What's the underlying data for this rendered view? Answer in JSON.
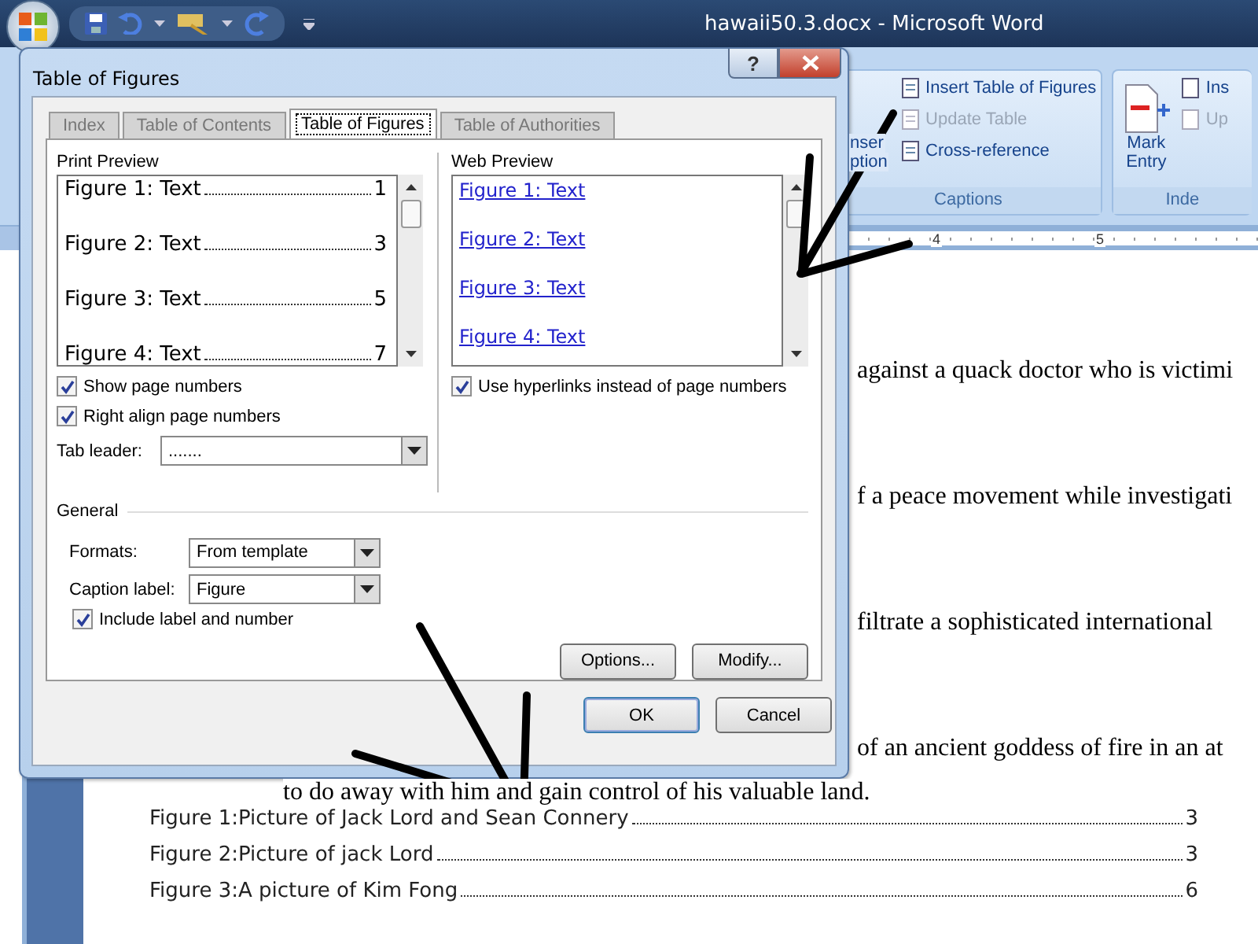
{
  "word_window": {
    "title": "hawaii50.3.docx - Microsoft Word"
  },
  "ribbon": {
    "cut_button_lines": [
      "nser",
      "ption"
    ],
    "captions_group": {
      "label": "Captions",
      "items": [
        {
          "label": "Insert Table of Figures",
          "disabled": false
        },
        {
          "label": "Update Table",
          "disabled": true
        },
        {
          "label": "Cross-reference",
          "disabled": false
        }
      ]
    },
    "index_group": {
      "label": "Inde",
      "mark_entry": [
        "Mark",
        "Entry"
      ],
      "items": [
        {
          "label": "Ins",
          "disabled": false
        },
        {
          "label": "Up",
          "disabled": true
        }
      ]
    }
  },
  "ruler": {
    "numbers": [
      "4",
      "5"
    ]
  },
  "document": {
    "lines": [
      "against a quack doctor who is victimi",
      "f a peace movement while investigati",
      "filtrate a sophisticated international",
      "of an ancient goddess of fire in an at"
    ],
    "continuation": "to do away with him and gain control of his valuable land.",
    "table_of_figures": [
      {
        "entry": "Figure 1:Picture of Jack Lord and Sean Connery",
        "page": "3"
      },
      {
        "entry": "Figure 2:Picture of jack Lord",
        "page": "3"
      },
      {
        "entry": "Figure 3:A picture of Kim Fong",
        "page": "6"
      }
    ]
  },
  "dialog": {
    "title": "Table of Figures",
    "help": "?",
    "tabs": [
      {
        "label": "Index",
        "selected": false
      },
      {
        "label": "Table of Contents",
        "selected": false
      },
      {
        "label": "Table of Figures",
        "selected": true
      },
      {
        "label": "Table of Authorities",
        "selected": false
      }
    ],
    "print_preview": {
      "label": "Print Preview",
      "entries": [
        {
          "text": "Figure 1: Text",
          "page": "1"
        },
        {
          "text": "Figure 2: Text",
          "page": "3"
        },
        {
          "text": "Figure 3: Text",
          "page": "5"
        },
        {
          "text": "Figure 4: Text",
          "page": "7"
        }
      ]
    },
    "web_preview": {
      "label": "Web Preview",
      "links": [
        "Figure 1: Text",
        "Figure 2: Text",
        "Figure 3: Text",
        "Figure 4: Text"
      ]
    },
    "show_page_numbers": {
      "label": "Show page numbers",
      "checked": true
    },
    "right_align": {
      "label": "Right align page numbers",
      "checked": true
    },
    "tab_leader": {
      "label": "Tab leader:",
      "value": "......."
    },
    "use_hyperlinks": {
      "label": "Use hyperlinks instead of page numbers",
      "checked": true
    },
    "general": {
      "label": "General",
      "formats": {
        "label": "Formats:",
        "value": "From template"
      },
      "caption_label": {
        "label": "Caption label:",
        "value": "Figure"
      },
      "include_label": {
        "label": "Include label and number",
        "checked": true
      }
    },
    "buttons": {
      "options": "Options...",
      "modify": "Modify...",
      "ok": "OK",
      "cancel": "Cancel"
    }
  }
}
